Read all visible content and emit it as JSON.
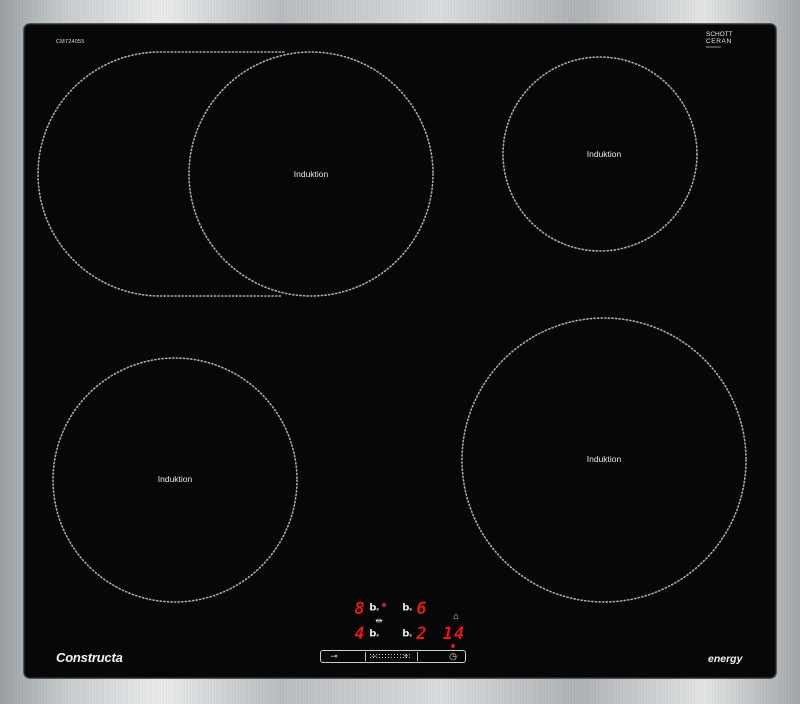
{
  "model": "CM724055",
  "badge": {
    "line1": "SCHOTT",
    "line2": "CERAN",
    "line3": "000000000"
  },
  "zones": [
    {
      "id": "front-left-flex",
      "label": "Induktion"
    },
    {
      "id": "top-right",
      "label": "Induktion"
    },
    {
      "id": "bottom-left",
      "label": "Induktion"
    },
    {
      "id": "bottom-right",
      "label": "Induktion"
    }
  ],
  "controls": {
    "zone_top_left_level": "8",
    "zone_top_right_level": "6",
    "zone_bottom_left_level": "4",
    "zone_bottom_right_level": "2",
    "boost_symbol": "b",
    "boost_sub": "s",
    "timer_value": "14",
    "flex_link_icon": "flex-link-icon",
    "bell_icon": "bell-icon",
    "key_icon": "key-lock-icon",
    "minus_icon": "minus-icon",
    "plus_icon": "plus-icon",
    "timer_icon": "clock-icon",
    "key_glyph": "⊸",
    "minus_glyph": "−",
    "plus_glyph": "+",
    "clock_glyph": "◷",
    "bell_glyph": "⌂",
    "flex_glyph": "⇹"
  },
  "brand": "Constructa",
  "energy_label": "energy",
  "colors": {
    "glass": "#070707",
    "display_red": "#e21a1a",
    "frame": "#c9ced1"
  }
}
